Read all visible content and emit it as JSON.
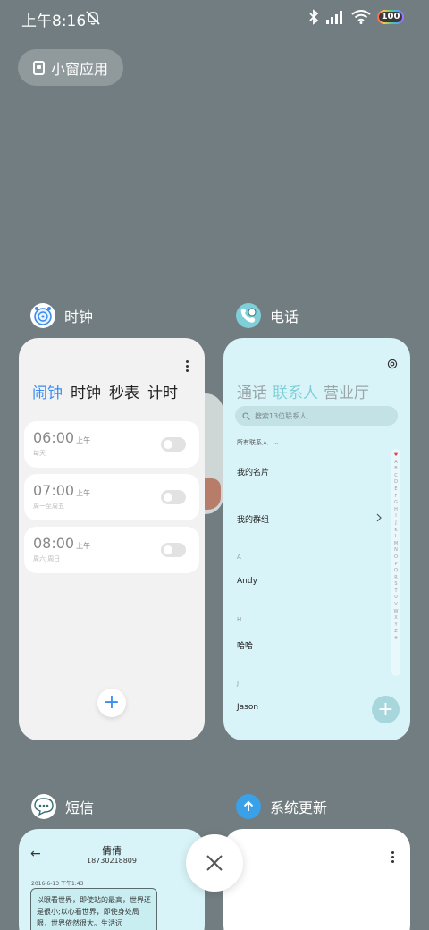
{
  "status_bar": {
    "time": "上午8:16",
    "battery": "100"
  },
  "small_window": {
    "label": "小窗应用"
  },
  "apps": {
    "clock": {
      "name": "时钟",
      "tabs": [
        "闹钟",
        "时钟",
        "秒表",
        "计时"
      ],
      "active_tab": 0,
      "alarms": [
        {
          "time": "06:00",
          "ampm": "上午",
          "repeat": "每天",
          "enabled": false
        },
        {
          "time": "07:00",
          "ampm": "上午",
          "repeat": "周一至周五",
          "enabled": false
        },
        {
          "time": "08:00",
          "ampm": "上午",
          "repeat": "周六 周日",
          "enabled": false
        }
      ],
      "add_label": "+"
    },
    "phone": {
      "name": "电话",
      "tabs": [
        "通话",
        "联系人",
        "营业厅"
      ],
      "active_tab": 1,
      "search_placeholder": "搜索13位联系人",
      "filter": "所有联系人",
      "rows": {
        "my_card": "我的名片",
        "my_groups": "我的群组",
        "letter_a": "A",
        "andy": "Andy",
        "letter_h": "H",
        "haha": "哈哈",
        "letter_j": "J",
        "jason": "Jason"
      },
      "alpha_index": [
        "♥",
        "A",
        "B",
        "C",
        "D",
        "E",
        "F",
        "G",
        "H",
        "I",
        "J",
        "K",
        "L",
        "M",
        "N",
        "O",
        "P",
        "Q",
        "R",
        "S",
        "T",
        "U",
        "V",
        "W",
        "X",
        "Y",
        "Z",
        "#"
      ],
      "add_label": "+"
    },
    "sms": {
      "name": "短信",
      "contact_name": "倩倩",
      "contact_number": "18730218809",
      "date": "2016-6-13 下午1:43",
      "message": "以眼看世界，即使站的最高，世界还是很小;以心看世界，即使身处局限，世界依然很大。生活远"
    },
    "update": {
      "name": "系统更新"
    }
  },
  "colors": {
    "background": "#717d80",
    "clock_accent": "#3a8cf0",
    "phone_card": "#d9f4f8",
    "phone_accent": "#7fcfd8"
  }
}
